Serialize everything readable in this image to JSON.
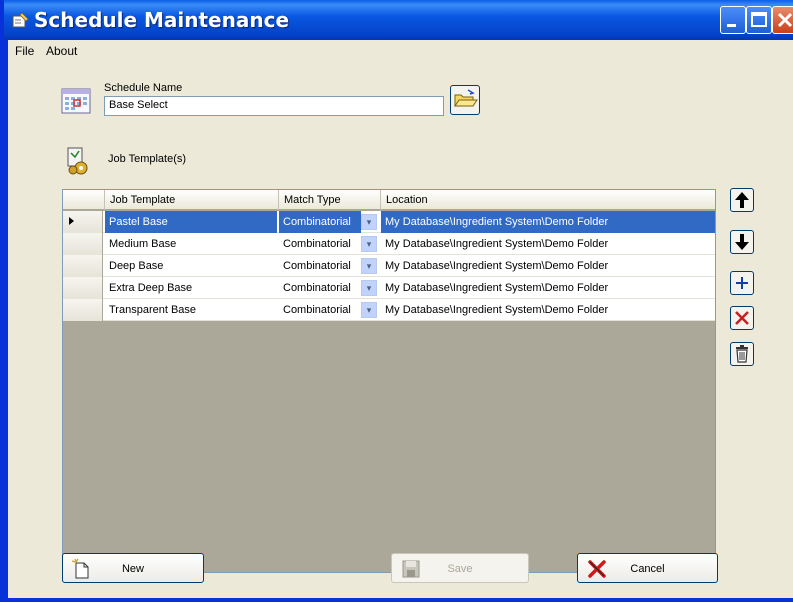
{
  "window": {
    "title": "Schedule Maintenance"
  },
  "menu": {
    "items": [
      "File",
      "About"
    ]
  },
  "schedule": {
    "label": "Schedule Name",
    "value": "Base Select"
  },
  "job_templates": {
    "label": "Job Template(s)"
  },
  "grid": {
    "columns": [
      "Job Template",
      "Match Type",
      "Location"
    ],
    "rows": [
      {
        "template": "Pastel Base",
        "match": "Combinatorial",
        "location": "My Database\\Ingredient System\\Demo Folder",
        "selected": true
      },
      {
        "template": "Medium Base",
        "match": "Combinatorial",
        "location": "My Database\\Ingredient System\\Demo Folder"
      },
      {
        "template": "Deep Base",
        "match": "Combinatorial",
        "location": "My Database\\Ingredient System\\Demo Folder"
      },
      {
        "template": "Extra Deep Base",
        "match": "Combinatorial",
        "location": "My Database\\Ingredient System\\Demo Folder"
      },
      {
        "template": "Transparent Base",
        "match": "Combinatorial",
        "location": "My Database\\Ingredient System\\Demo Folder"
      }
    ]
  },
  "side_buttons": [
    "move-up-icon",
    "move-down-icon",
    "add-icon",
    "remove-icon",
    "delete-icon"
  ],
  "buttons": {
    "new": "New",
    "save": "Save",
    "cancel": "Cancel"
  },
  "colors": {
    "title_bar": "#0a58e2",
    "selection": "#316ac5",
    "dialog": "#ece9d8",
    "grid_empty": "#aca899"
  }
}
